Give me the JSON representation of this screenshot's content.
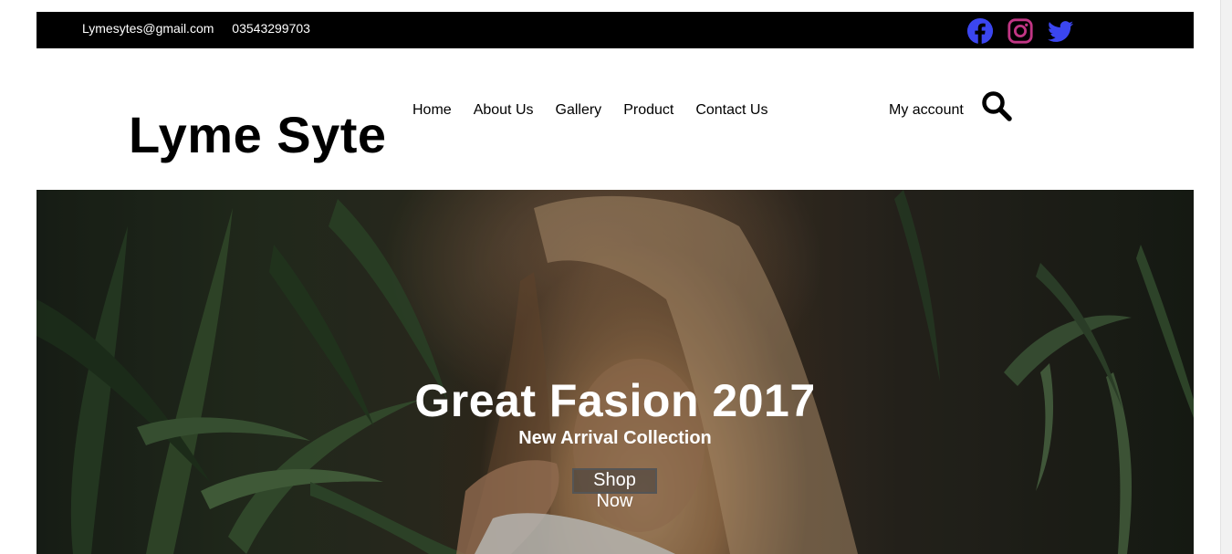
{
  "topbar": {
    "email": "Lymesytes@gmail.com",
    "phone": "03543299703"
  },
  "social": {
    "icons": [
      "facebook-icon",
      "instagram-icon",
      "twitter-icon"
    ],
    "colors": {
      "facebook": "#3b46f0",
      "instagram": "#c13584",
      "twitter": "#3b46f0"
    }
  },
  "header": {
    "logo": "Lyme Syte",
    "nav": [
      "Home",
      "About Us",
      "Gallery",
      "Product",
      "Contact Us"
    ],
    "account": "My account"
  },
  "hero": {
    "title": "Great Fasion 2017",
    "subtitle": "New Arrival Collection",
    "button": "Shop Now"
  }
}
